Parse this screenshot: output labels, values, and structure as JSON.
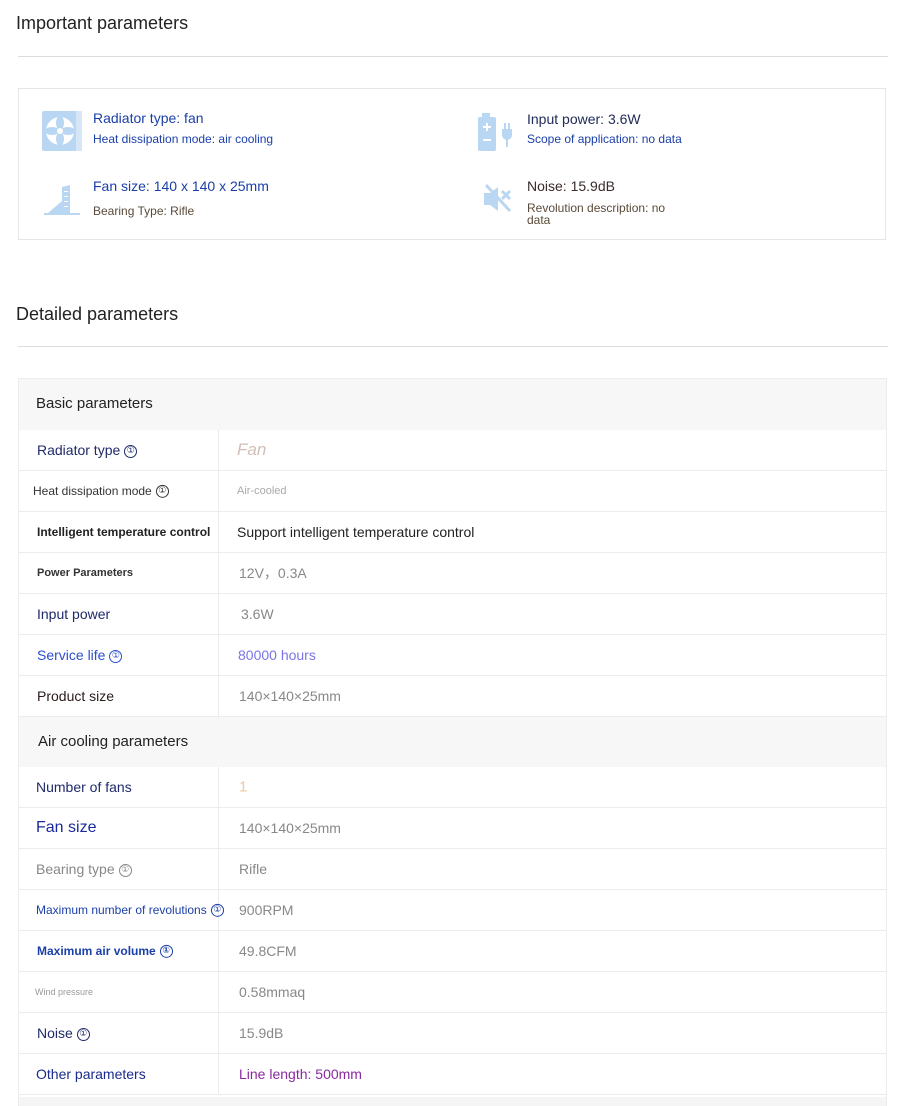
{
  "important": {
    "title": "Important parameters",
    "items": [
      {
        "icon": "radiator-fan-icon",
        "line1": "Radiator type: fan",
        "line2": "Heat dissipation mode: air cooling"
      },
      {
        "icon": "input-power-icon",
        "line1": "Input power: 3.6W",
        "line2": "Scope of application: no data"
      },
      {
        "icon": "fan-size-icon",
        "line1": "Fan size: 140 x 140 x 25mm",
        "line2": "Bearing Type: Rifle"
      },
      {
        "icon": "noise-icon",
        "line1": "Noise: 15.9dB",
        "line2": "Revolution description: no",
        "line3": "data"
      }
    ]
  },
  "detailed": {
    "title": "Detailed parameters",
    "groups": [
      {
        "name": "Basic parameters",
        "rows": [
          {
            "key": "Radiator type",
            "info": true,
            "value": "Fan"
          },
          {
            "key": "Heat dissipation mode",
            "info": true,
            "value": "Air-cooled"
          },
          {
            "key": "Intelligent temperature control",
            "info": false,
            "value": "Support intelligent temperature control"
          },
          {
            "key": "Power Parameters",
            "info": false,
            "value": "12V，0.3A"
          },
          {
            "key": "Input power",
            "info": false,
            "value": "3.6W"
          },
          {
            "key": "Service life",
            "info": true,
            "value": "80000 hours"
          },
          {
            "key": "Product size",
            "info": false,
            "value": "140×140×25mm"
          }
        ]
      },
      {
        "name": "Air cooling parameters",
        "rows": [
          {
            "key": "Number of fans",
            "info": false,
            "value": "1"
          },
          {
            "key": "Fan size",
            "info": false,
            "value": "140×140×25mm"
          },
          {
            "key": "Bearing type",
            "info": true,
            "value": "Rifle"
          },
          {
            "key": "Maximum number of revolutions",
            "info": true,
            "value": "900RPM"
          },
          {
            "key": "Maximum air volume",
            "info": true,
            "value": "49.8CFM"
          },
          {
            "key": "Wind pressure",
            "info": false,
            "value": "0.58mmaq"
          },
          {
            "key": "Noise",
            "info": true,
            "value": "15.9dB"
          },
          {
            "key": "Other parameters",
            "info": false,
            "value": "Line length: 500mm"
          }
        ]
      }
    ]
  },
  "info_glyph": "①",
  "colors": {
    "blue": "#1a3fa8",
    "light_icon": "#b9d6f2",
    "value_gray": "#888888"
  }
}
